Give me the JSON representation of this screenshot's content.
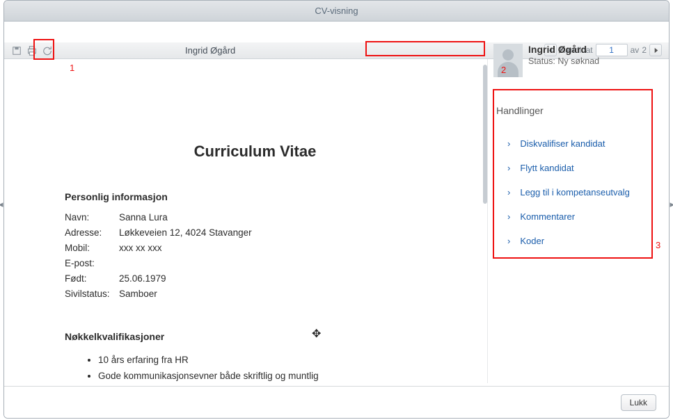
{
  "window": {
    "title": "CV-visning"
  },
  "header": {
    "candidate_name": "Ingrid Øgård",
    "pager": {
      "label": "Kandidat",
      "current": "1",
      "of_label": "av",
      "total": "2"
    }
  },
  "cv": {
    "title": "Curriculum Vitae",
    "personal_heading": "Personlig informasjon",
    "fields": {
      "name": {
        "label": "Navn:",
        "value": "Sanna Lura"
      },
      "address": {
        "label": "Adresse:",
        "value": "Løkkeveien 12, 4024 Stavanger"
      },
      "mobile": {
        "label": "Mobil:",
        "value": "xxx xx xxx"
      },
      "email": {
        "label": "E-post:",
        "value": ""
      },
      "born": {
        "label": "Født:",
        "value": "25.06.1979"
      },
      "civil": {
        "label": "Sivilstatus:",
        "value": "Samboer"
      }
    },
    "quals_heading": "Nøkkelkvalifikasjoner",
    "quals": {
      "0": "10 års erfaring fra HR",
      "1": "Gode kommunikasjonsevner både skriftlig og muntlig"
    }
  },
  "sidebar": {
    "candidate": {
      "name": "Ingrid Øgård",
      "status": "Status: Ny søknad"
    },
    "actions_title": "Handlinger",
    "actions": {
      "0": "Diskvalifiser kandidat",
      "1": "Flytt kandidat",
      "2": "Legg til i kompetanseutvalg",
      "3": "Kommentarer",
      "4": "Koder"
    }
  },
  "footer": {
    "close": "Lukk"
  },
  "callouts": {
    "1": "1",
    "2": "2",
    "3": "3"
  }
}
